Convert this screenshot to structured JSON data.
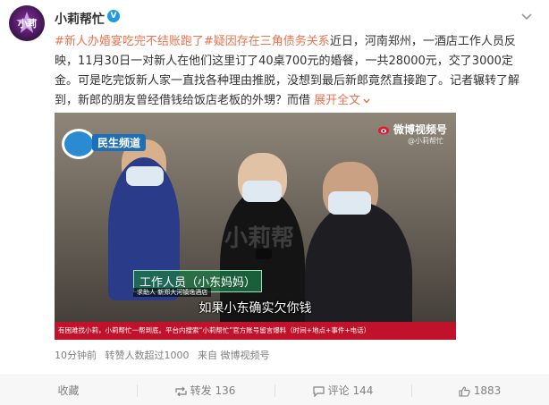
{
  "user": {
    "avatar_text": "小莉",
    "name": "小莉帮忙",
    "verified_mark": "V"
  },
  "post": {
    "hashtag1": "#新人办婚宴吃完不结账跑了#",
    "hashtag2": "疑因存在三角债务关系",
    "body": "近日，河南郑州，一酒店工作人员反映，11月30日一对新人在他们这里订了40桌700元的婚餐，一共28000元，交了3000定金。可是吃完饭新人家一直找各种理由推脱，没想到最后新郎竟然直接跑了。记者辗转了解到，新郎的朋友曾经借钱给饭店老板的外甥？而借",
    "expand": "展开全文",
    "expand_icon": "chevron-down-icon"
  },
  "video": {
    "channel": "民生频道",
    "platform": "微博视频号",
    "platform_sub": "@小莉帮忙",
    "name_tag": "工作人员（小东妈妈）",
    "name_tag_sub": "求助人  新郑大河镇逸酒店",
    "subtitle": "如果小东确实欠你钱",
    "ticker": "有困难找小莉，小莉帮忙一帮到底。平台内搜索“小莉帮忙”官方账号留言爆料（时间+地点+事件+电话）",
    "watermark": "小莉帮"
  },
  "meta": {
    "time": "10分钟前",
    "likes_text": "转赞人数超过1000",
    "source": "来自 微博视频号"
  },
  "actions": {
    "favorite": "收藏",
    "repost": "转发 136",
    "comment": "评论 144",
    "like": "1883"
  },
  "colors": {
    "link": "#eb7350",
    "verified": "#1e9be8",
    "ticker": "#c0122a"
  }
}
